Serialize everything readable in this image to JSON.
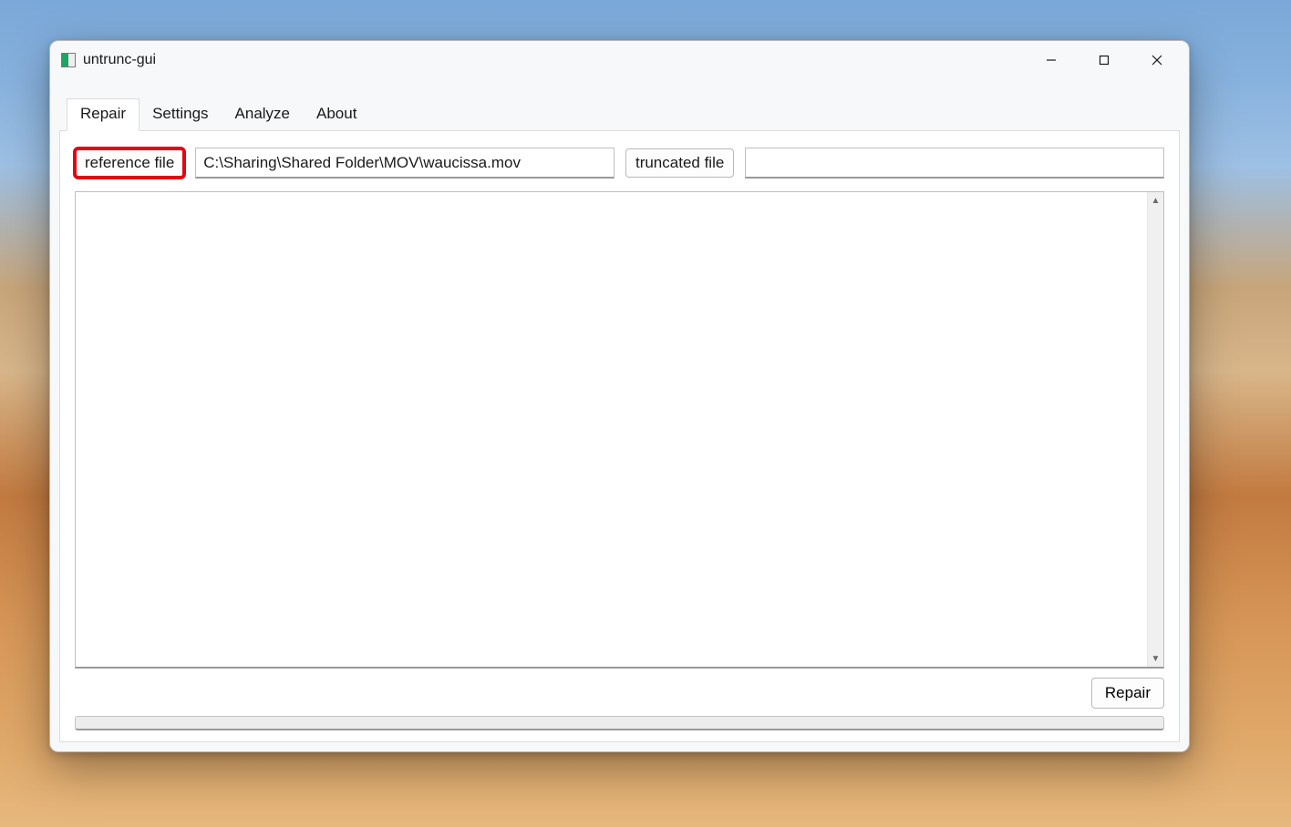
{
  "window": {
    "title": "untrunc-gui"
  },
  "tabs": {
    "items": [
      "Repair",
      "Settings",
      "Analyze",
      "About"
    ],
    "active_index": 0
  },
  "repair": {
    "reference_button": "reference file",
    "reference_value": "C:\\Sharing\\Shared Folder\\MOV\\waucissa.mov",
    "truncated_button": "truncated file",
    "truncated_value": "",
    "log_text": "",
    "repair_button": "Repair"
  },
  "highlight": {
    "target": "reference-file-button"
  }
}
